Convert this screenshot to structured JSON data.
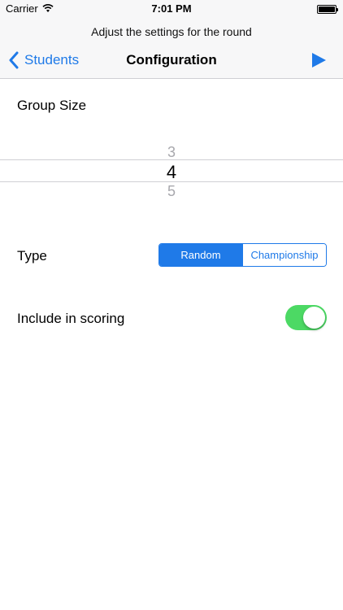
{
  "status_bar": {
    "carrier": "Carrier",
    "time": "7:01 PM"
  },
  "header": {
    "prompt": "Adjust the settings for the round",
    "back_label": "Students",
    "title": "Configuration",
    "action_icon": "play-icon"
  },
  "group_size": {
    "label": "Group Size",
    "options_visible": [
      "3",
      "4",
      "5"
    ],
    "selected": "4"
  },
  "type": {
    "label": "Type",
    "options": [
      "Random",
      "Championship"
    ],
    "selected": "Random"
  },
  "scoring": {
    "label": "Include in scoring",
    "enabled": true
  },
  "colors": {
    "accent": "#1f7ae8",
    "toggle_on": "#4cd964",
    "picker_dim": "#a8a8ad"
  }
}
